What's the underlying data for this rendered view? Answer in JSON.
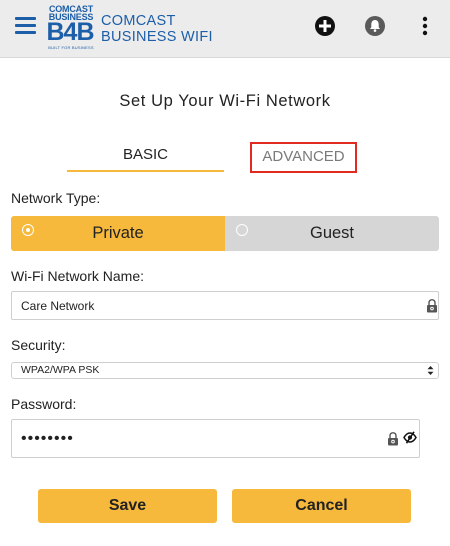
{
  "header": {
    "logo_line1": "COMCAST",
    "logo_line2": "BUSINESS",
    "logo_mark": "B4B",
    "logo_tagline": "BUILT FOR BUSINESS",
    "brand_line1": "COMCAST",
    "brand_line2": "BUSINESS WIFI",
    "brand_color": "#1d5ea8",
    "icons": [
      "menu-icon",
      "add-icon",
      "notifications-icon",
      "more-options-icon"
    ]
  },
  "page": {
    "title": "Set Up Your Wi-Fi Network"
  },
  "tabs": {
    "basic": "BASIC",
    "advanced": "ADVANCED",
    "active": "BASIC"
  },
  "network_type": {
    "label": "Network Type:",
    "options": [
      "Private",
      "Guest"
    ],
    "selected": "Private"
  },
  "wifi_name": {
    "label": "Wi-Fi Network Name:",
    "value": "Care Network"
  },
  "security": {
    "label": "Security:",
    "value": "WPA2/WPA PSK"
  },
  "password": {
    "label": "Password:",
    "value": "••••••••"
  },
  "buttons": {
    "save": "Save",
    "cancel": "Cancel"
  },
  "colors": {
    "accent": "#f6b93b",
    "highlight_box": "#e02b20",
    "inactive_segment": "#d6d6d6"
  }
}
